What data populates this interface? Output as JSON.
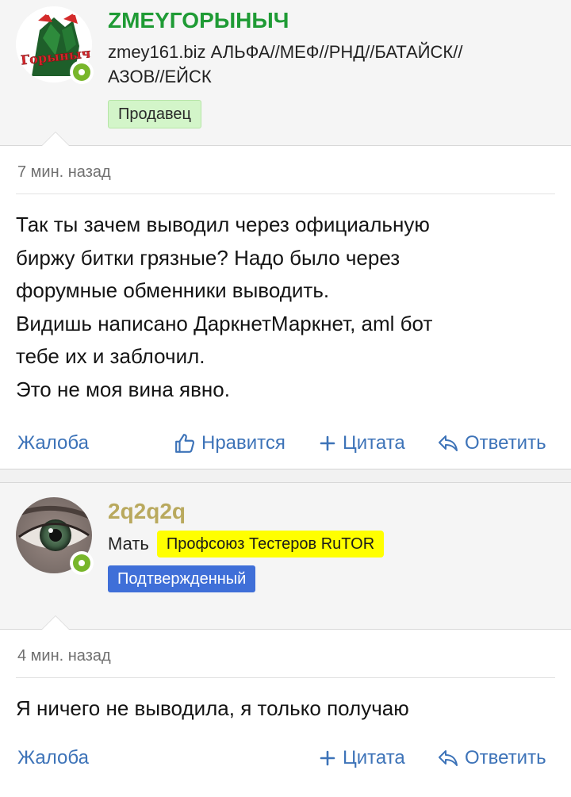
{
  "posts": [
    {
      "username": "ZMEYГОРЫНЫЧ",
      "user_title": "zmey161.biz АЛЬФА//МЕФ//РНД//БАТАЙСК//АЗОВ//ЕЙСК",
      "user_title_line1": "zmey161.biz АЛЬФА//МЕФ//РНД//БАТАЙСК//",
      "user_title_line2": "АЗОВ//ЕЙСК",
      "avatar_text": "Горыныч",
      "badge": "Продавец",
      "time": "7 мин. назад",
      "message_lines": [
        "Так ты зачем выводил через официальную",
        "биржу битки грязные? Надо было через",
        "форумные обменники выводить.",
        "Видишь написано ДаркнетМаркнет, aml бот",
        "тебе их и заблочил.",
        "Это не моя вина явно."
      ],
      "actions": {
        "report": "Жалоба",
        "like": "Нравится",
        "quote": "Цитата",
        "reply": "Ответить"
      }
    },
    {
      "username": "2q2q2q",
      "user_title": "Мать",
      "union_badge": "Профсоюз Тестеров RuTOR",
      "badge": "Подтвержденный",
      "time": "4 мин. назад",
      "message_lines": [
        "Я ничего не выводила, я только получаю"
      ],
      "actions": {
        "report": "Жалоба",
        "quote": "Цитата",
        "reply": "Ответить"
      }
    }
  ],
  "colors": {
    "link": "#3d73b8",
    "username_1": "#1f9b35",
    "username_2": "#b9a95e",
    "online": "#78b62b",
    "seller_badge": "#d3f5c9",
    "union_badge": "#ffff00",
    "verified_badge": "#3f6fd8"
  }
}
